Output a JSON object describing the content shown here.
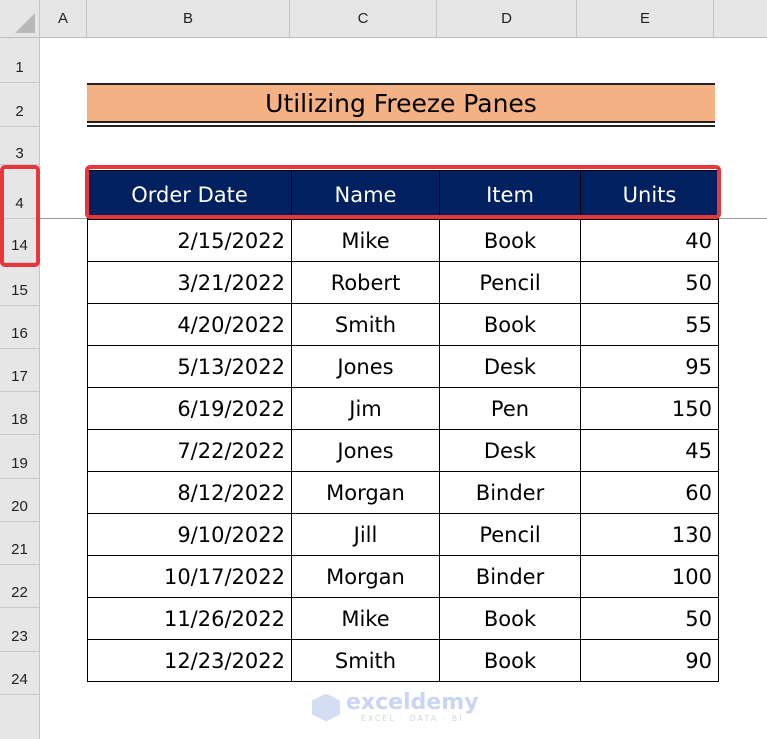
{
  "columns": [
    "A",
    "B",
    "C",
    "D",
    "E"
  ],
  "rows_visible": [
    "1",
    "2",
    "3",
    "4",
    "14",
    "15",
    "16",
    "17",
    "18",
    "19",
    "20",
    "21",
    "22",
    "23",
    "24"
  ],
  "title": "Utilizing Freeze Panes",
  "table": {
    "headers": [
      "Order Date",
      "Name",
      "Item",
      "Units"
    ],
    "rows": [
      [
        "2/15/2022",
        "Mike",
        "Book",
        "40"
      ],
      [
        "3/21/2022",
        "Robert",
        "Pencil",
        "50"
      ],
      [
        "4/20/2022",
        "Smith",
        "Book",
        "55"
      ],
      [
        "5/13/2022",
        "Jones",
        "Desk",
        "95"
      ],
      [
        "6/19/2022",
        "Jim",
        "Pen",
        "150"
      ],
      [
        "7/22/2022",
        "Jones",
        "Desk",
        "45"
      ],
      [
        "8/12/2022",
        "Morgan",
        "Binder",
        "60"
      ],
      [
        "9/10/2022",
        "Jill",
        "Pencil",
        "130"
      ],
      [
        "10/17/2022",
        "Morgan",
        "Binder",
        "100"
      ],
      [
        "11/26/2022",
        "Mike",
        "Book",
        "50"
      ],
      [
        "12/23/2022",
        "Smith",
        "Book",
        "90"
      ]
    ]
  },
  "colors": {
    "header_fill": "#002060",
    "title_fill": "#f4b183",
    "highlight": "#e8363d"
  },
  "watermark": {
    "name": "exceldemy",
    "tagline": "EXCEL · DATA · BI"
  }
}
